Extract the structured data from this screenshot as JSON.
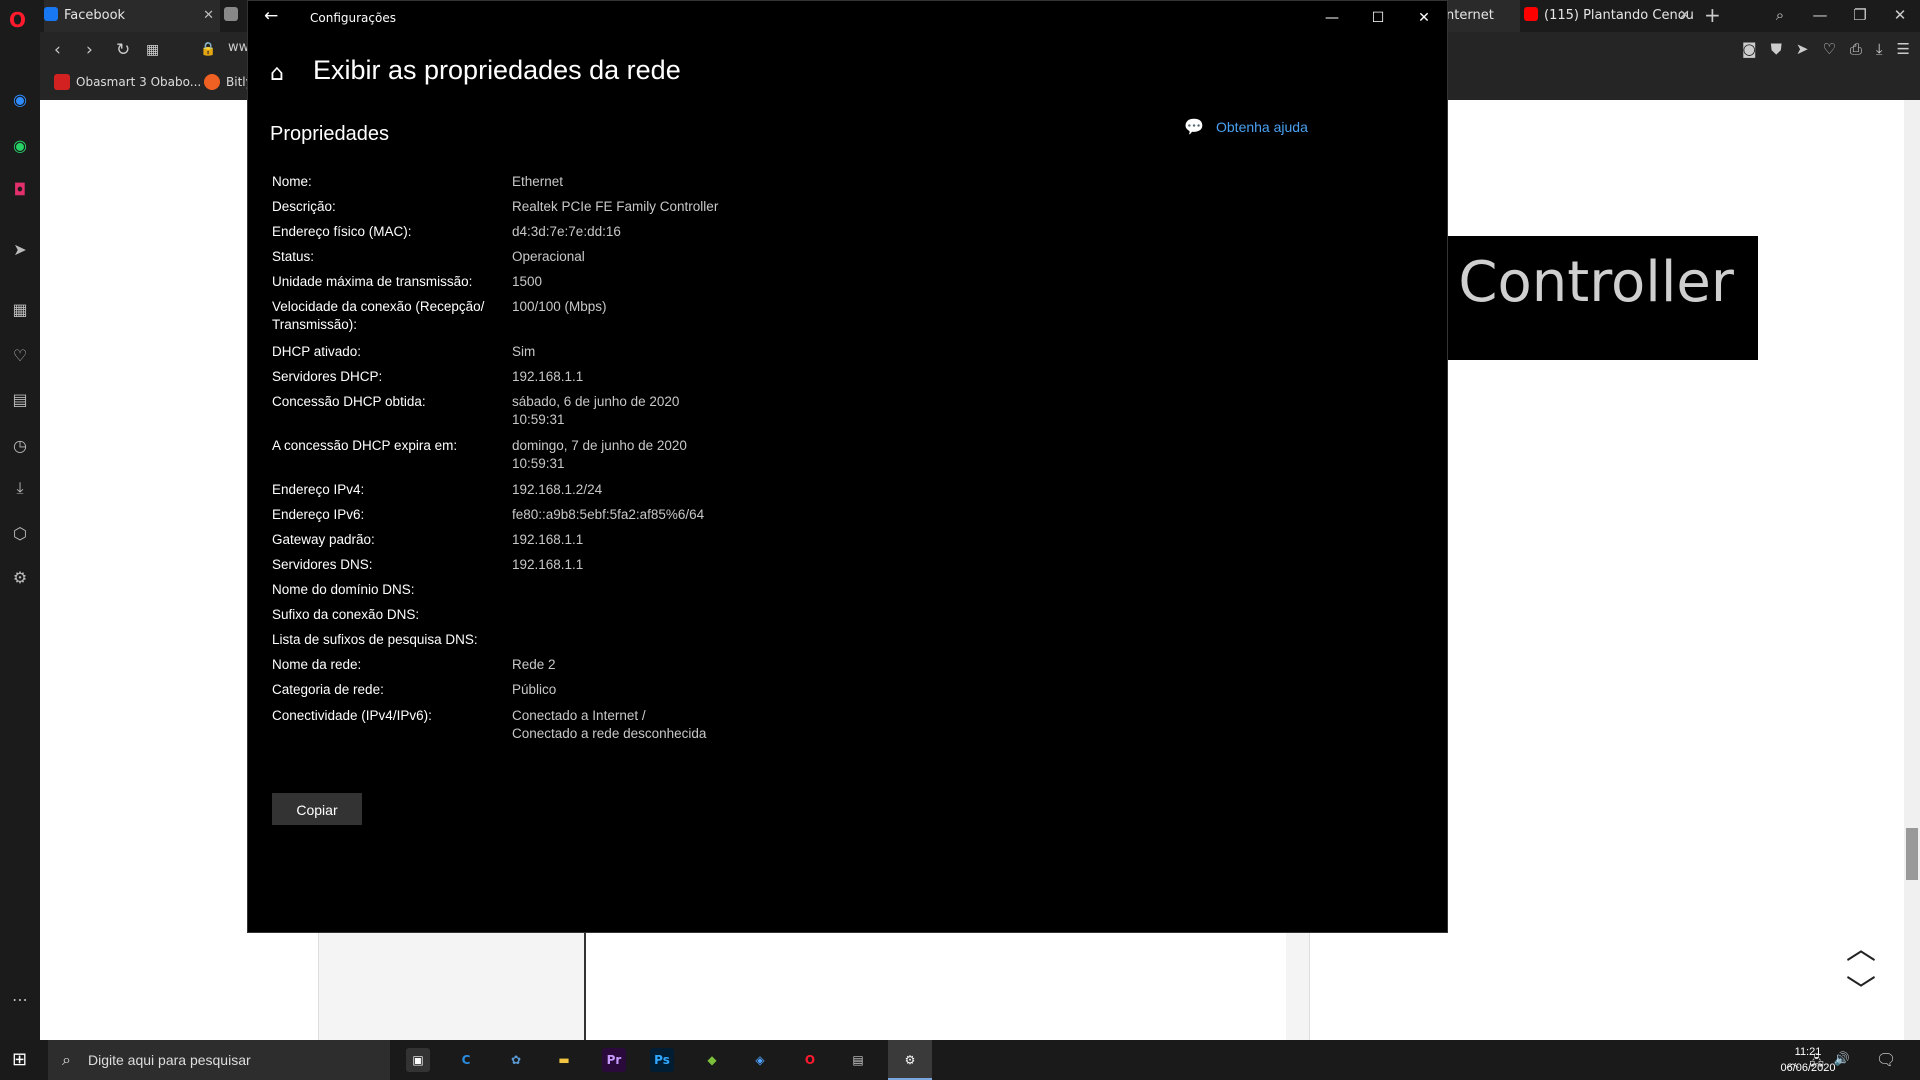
{
  "browser": {
    "tabs": [
      {
        "label": "Facebook"
      },
      {
        "label": "nternet"
      },
      {
        "label": "(115) Plantando Cenou"
      }
    ],
    "new_tab_label": "+",
    "url_stub": "ww",
    "bookmarks": [
      {
        "label": "Obasmart 3 Obabo..."
      },
      {
        "label": "Bitly"
      }
    ],
    "colors": {
      "opera_red": "#ff1b2d",
      "youtube_red": "#ff0000",
      "facebook_blue": "#1877f2"
    }
  },
  "settings": {
    "window_title": "Configurações",
    "page_title": "Exibir as propriedades da rede",
    "section_title": "Propriedades",
    "help_link": "Obtenha ajuda",
    "copy_button": "Copiar",
    "properties": [
      {
        "label": "Nome:",
        "value": "Ethernet"
      },
      {
        "label": "Descrição:",
        "value": "Realtek PCIe FE Family Controller"
      },
      {
        "label": "Endereço físico (MAC):",
        "value": "d4:3d:7e:7e:dd:16"
      },
      {
        "label": "Status:",
        "value": "Operacional"
      },
      {
        "label": "Unidade máxima de transmissão:",
        "value": "1500"
      },
      {
        "label": "Velocidade da conexão (Recepção/",
        "label2": "Transmissão):",
        "value": "100/100 (Mbps)"
      },
      {
        "label": "DHCP ativado:",
        "value": "Sim"
      },
      {
        "label": "Servidores DHCP:",
        "value": "192.168.1.1"
      },
      {
        "label": "Concessão DHCP obtida:",
        "value": "sábado, 6 de junho de 2020",
        "value2": "10:59:31"
      },
      {
        "label": "A concessão DHCP expira em:",
        "value": "domingo, 7 de junho de 2020",
        "value2": "10:59:31"
      },
      {
        "label": "Endereço IPv4:",
        "value": "192.168.1.2/24"
      },
      {
        "label": "Endereço IPv6:",
        "value": "fe80::a9b8:5ebf:5fa2:af85%6/64"
      },
      {
        "label": "Gateway padrão:",
        "value": "192.168.1.1"
      },
      {
        "label": "Servidores DNS:",
        "value": "192.168.1.1"
      },
      {
        "label": "Nome do domínio DNS:",
        "value": ""
      },
      {
        "label": "Sufixo da conexão DNS:",
        "value": ""
      },
      {
        "label": "Lista de sufixos de pesquisa DNS:",
        "value": ""
      },
      {
        "label": "Nome da rede:",
        "value": "Rede 2"
      },
      {
        "label": "Categoria de rede:",
        "value": "Público"
      },
      {
        "label": "Conectividade (IPv4/IPv6):",
        "value": "Conectado a Internet /",
        "value2": "Conectado a rede desconhecida"
      }
    ]
  },
  "callout": {
    "text": "Realtek PCIe FE Family Controller",
    "annotation_color": "#ff00ff"
  },
  "taskbar": {
    "search_placeholder": "Digite aqui para pesquisar",
    "clock_time": "11:21",
    "clock_date": "06/06/2020"
  }
}
